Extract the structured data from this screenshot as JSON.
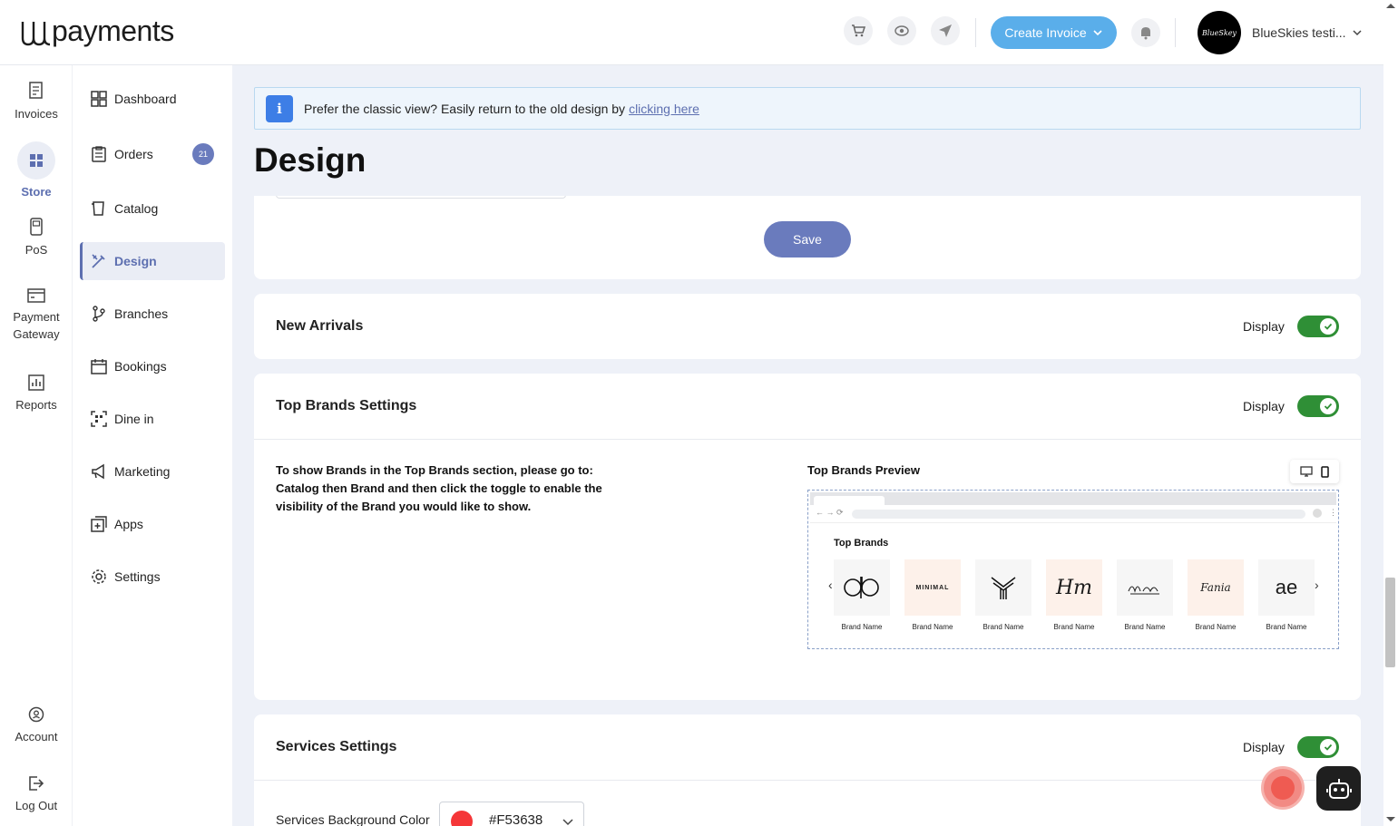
{
  "brand": {
    "logo_text": "payments"
  },
  "header": {
    "icons": [
      "cart-icon",
      "eye-icon",
      "send-icon"
    ],
    "create_invoice_label": "Create Invoice",
    "avatar_text": "BlueSkey",
    "account_name": "BlueSkies testi..."
  },
  "rail": {
    "items": [
      {
        "label": "Invoices",
        "icon": "invoice-icon"
      },
      {
        "label": "Store",
        "icon": "store-icon",
        "active": true
      },
      {
        "label": "PoS",
        "icon": "pos-icon"
      },
      {
        "label": "Payment Gateway",
        "icon": "payment-gateway-icon"
      },
      {
        "label": "Reports",
        "icon": "reports-icon"
      }
    ],
    "bottom": [
      {
        "label": "Account",
        "icon": "account-icon"
      },
      {
        "label": "Log Out",
        "icon": "logout-icon"
      }
    ]
  },
  "sidebar": {
    "items": [
      {
        "label": "Dashboard"
      },
      {
        "label": "Orders",
        "badge": "21"
      },
      {
        "label": "Catalog"
      },
      {
        "label": "Design",
        "active": true
      },
      {
        "label": "Branches"
      },
      {
        "label": "Bookings"
      },
      {
        "label": "Dine in"
      },
      {
        "label": "Marketing"
      },
      {
        "label": "Apps"
      },
      {
        "label": "Settings"
      }
    ]
  },
  "notice": {
    "text": "Prefer the classic view? Easily return to the old design by",
    "link": "clicking here"
  },
  "page": {
    "title": "Design"
  },
  "save_card": {
    "save_label": "Save"
  },
  "new_arrivals": {
    "title": "New Arrivals",
    "display_label": "Display",
    "enabled": true
  },
  "top_brands": {
    "title": "Top Brands Settings",
    "display_label": "Display",
    "enabled": true,
    "instructions": "To show Brands in the Top Brands section, please go to: Catalog then Brand and then click the toggle to enable the visibility of the Brand you would like to show.",
    "preview_title": "Top Brands Preview",
    "preview_heading": "Top Brands",
    "brands": [
      {
        "name": "Brand Name",
        "logo": "qb"
      },
      {
        "name": "Brand Name",
        "logo": "MINIMAL"
      },
      {
        "name": "Brand Name",
        "logo": "stripes"
      },
      {
        "name": "Brand Name",
        "logo": "Hm"
      },
      {
        "name": "Brand Name",
        "logo": "minimal-script"
      },
      {
        "name": "Brand Name",
        "logo": "Fania"
      },
      {
        "name": "Brand Name",
        "logo": "ae"
      }
    ]
  },
  "services": {
    "title": "Services Settings",
    "display_label": "Display",
    "enabled": true,
    "bg_color_label": "Services Background Color",
    "bg_color_value": "#F53638"
  },
  "colors": {
    "accent": "#5d6fb0",
    "toggle": "#2f8f36",
    "create_btn": "#5aaeea"
  }
}
